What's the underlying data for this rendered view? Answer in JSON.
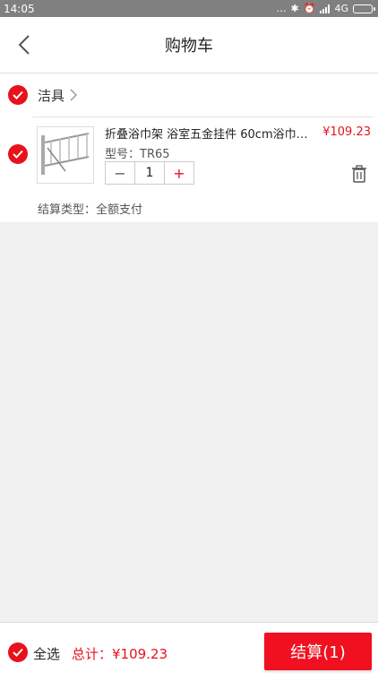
{
  "status_bar": {
    "time": "14:05",
    "network": "4G",
    "icons": [
      "ellipsis-icon",
      "bluetooth-icon",
      "alarm-icon",
      "signal-icon",
      "battery-icon"
    ]
  },
  "header": {
    "title": "购物车",
    "back_icon": "chevron-left-icon"
  },
  "cart": {
    "shop": {
      "name": "洁具",
      "checked": true
    },
    "items": [
      {
        "title": "折叠浴巾架 浴室五金挂件 60cm浴巾架...",
        "price": "¥109.23",
        "model": "型号：TR65",
        "quantity": "1",
        "checked": true,
        "delete_icon": "trash-icon"
      }
    ],
    "settle_type": "结算类型：全额支付"
  },
  "footer": {
    "select_all_label": "全选",
    "select_all_checked": true,
    "total_label": "总计：¥109.23",
    "checkout_label": "结算(1)"
  },
  "colors": {
    "accent": "#e8111c",
    "checkout_bg": "#f01020",
    "page_bg": "#f0f0f0",
    "status_bar_bg": "#808080"
  }
}
